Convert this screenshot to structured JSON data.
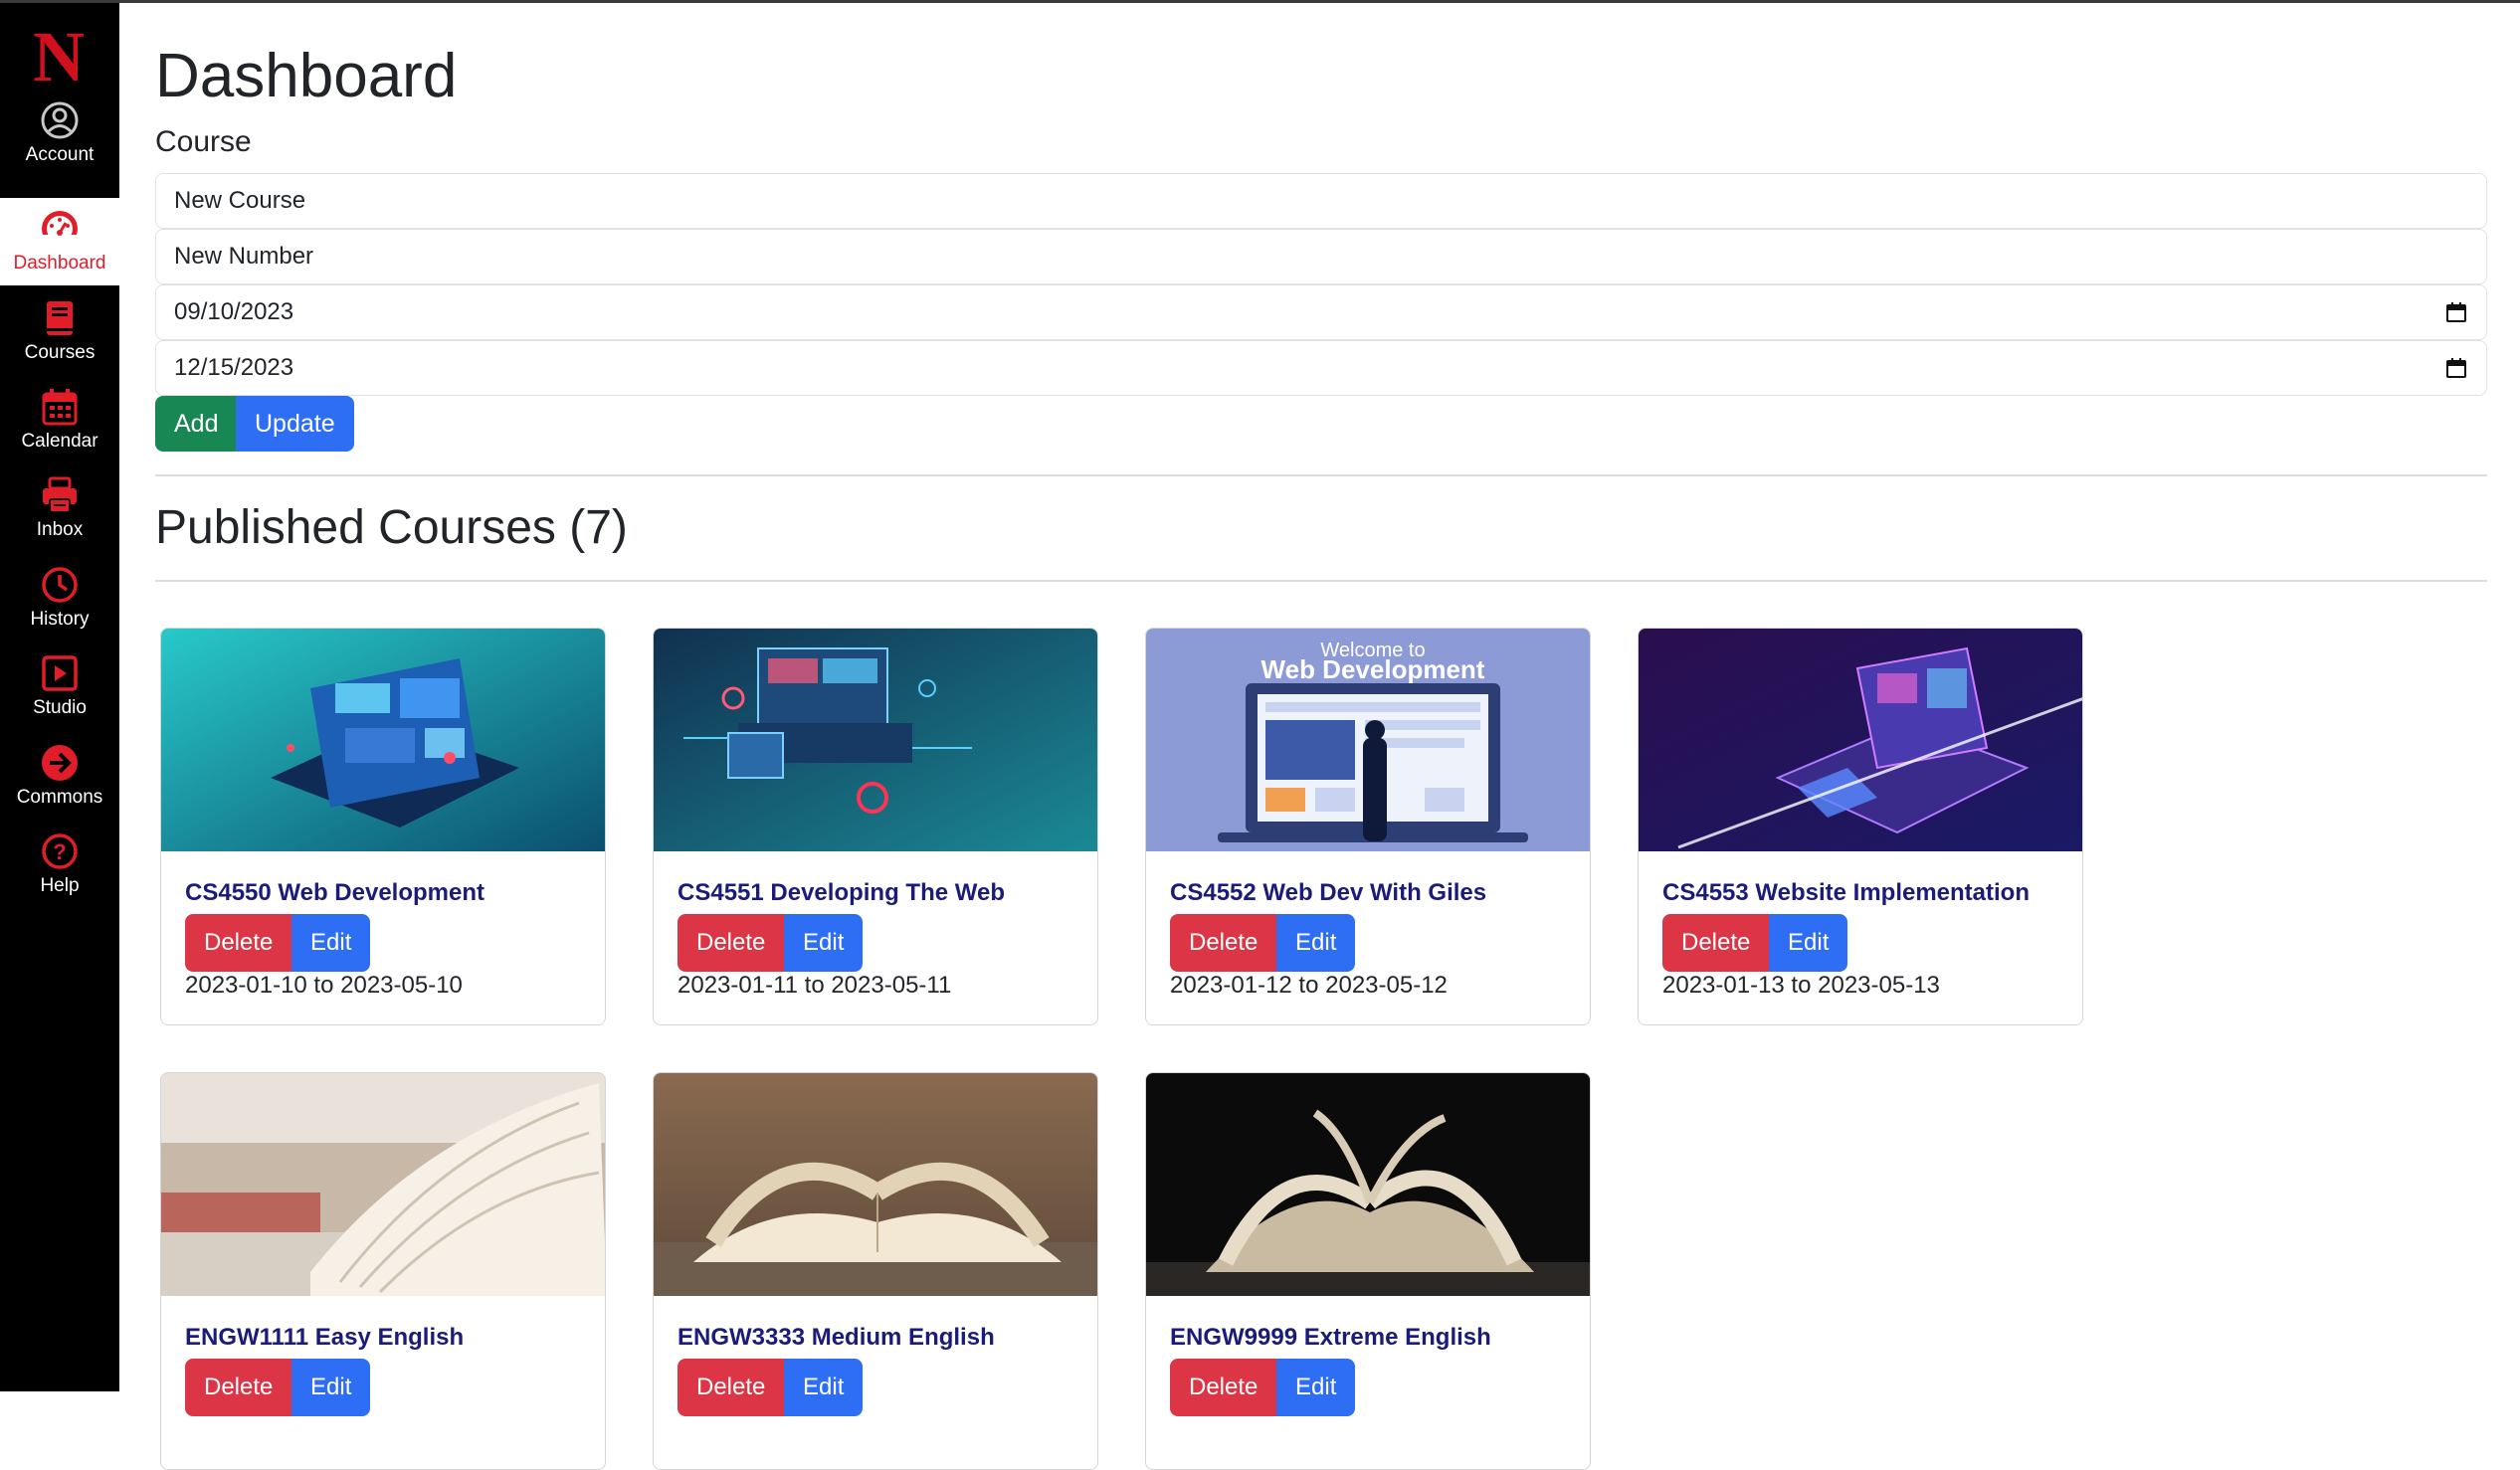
{
  "nav": {
    "logo_letter": "N",
    "items": [
      {
        "label": "Account",
        "icon": "account-icon"
      },
      {
        "label": "Dashboard",
        "icon": "dashboard-icon"
      },
      {
        "label": "Courses",
        "icon": "book-icon"
      },
      {
        "label": "Calendar",
        "icon": "calendar-icon"
      },
      {
        "label": "Inbox",
        "icon": "inbox-icon"
      },
      {
        "label": "History",
        "icon": "clock-icon"
      },
      {
        "label": "Studio",
        "icon": "play-icon"
      },
      {
        "label": "Commons",
        "icon": "arrow-right-icon"
      },
      {
        "label": "Help",
        "icon": "question-icon"
      }
    ],
    "active": "Dashboard",
    "accent_color": "#e11d2a"
  },
  "page": {
    "title": "Dashboard",
    "section_label": "Course",
    "form": {
      "name_value": "New Course",
      "number_value": "New Number",
      "start_date": "09/10/2023",
      "end_date": "12/15/2023"
    },
    "add_label": "Add",
    "update_label": "Update",
    "published_title": "Published Courses (7)"
  },
  "courses": [
    {
      "title": "CS4550 Web Development",
      "dates": "2023-01-10 to 2023-05-10",
      "delete_label": "Delete",
      "edit_label": "Edit",
      "image": "laptop-web-illustration"
    },
    {
      "title": "CS4551 Developing The Web",
      "dates": "2023-01-11 to 2023-05-11",
      "delete_label": "Delete",
      "edit_label": "Edit",
      "image": "circuit-laptop-illustration"
    },
    {
      "title": "CS4552 Web Dev With Giles",
      "dates": "2023-01-12 to 2023-05-12",
      "delete_label": "Delete",
      "edit_label": "Edit",
      "image": "welcome-web-dev-illustration",
      "image_heading": "Welcome to",
      "image_title": "Web Development"
    },
    {
      "title": "CS4553 Website Implementation",
      "dates": "2023-01-13 to 2023-05-13",
      "delete_label": "Delete",
      "edit_label": "Edit",
      "image": "isometric-laptop-illustration"
    },
    {
      "title": "ENGW1111 Easy English",
      "delete_label": "Delete",
      "edit_label": "Edit",
      "image": "open-book-photo-blurred"
    },
    {
      "title": "ENGW3333 Medium English",
      "delete_label": "Delete",
      "edit_label": "Edit",
      "image": "open-book-on-table-photo"
    },
    {
      "title": "ENGW9999 Extreme English",
      "delete_label": "Delete",
      "edit_label": "Edit",
      "image": "open-book-dark-photo"
    }
  ]
}
